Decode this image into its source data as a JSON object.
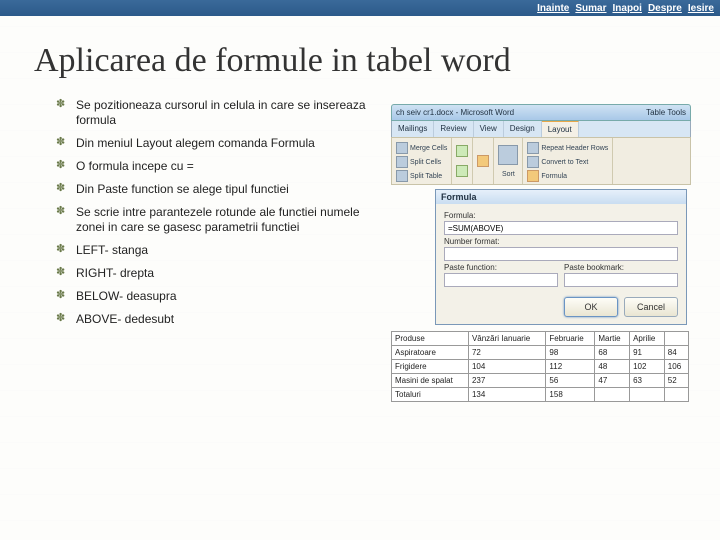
{
  "nav": {
    "inainte": "Inainte",
    "sumar": "Sumar",
    "inapoi": "Inapoi",
    "despre": "Despre",
    "iesire": "Iesire"
  },
  "title": "Aplicarea de formule in tabel word",
  "bullets": [
    "Se pozitioneaza cursorul in celula in care se insereaza formula",
    "Din meniul Layout alegem comanda Formula",
    "O formula incepe cu =",
    "Din Paste function se alege tipul functiei",
    "Se scrie intre parantezele rotunde ale functiei numele zonei in care se gasesc parametrii functiei",
    "LEFT- stanga",
    "RIGHT- drepta",
    "BELOW- deasupra",
    "ABOVE- dedesubt"
  ],
  "word": {
    "docTitle": "ch seiv cr1.docx - Microsoft Word",
    "toolsLabel": "Table Tools",
    "tabs": [
      "Mailings",
      "Review",
      "View",
      "Design",
      "Layout"
    ],
    "activeTab": "Layout",
    "ribbon": {
      "mergeCells": "Merge Cells",
      "splitCells": "Split Cells",
      "splitTable": "Split Table",
      "repeatHeader": "Repeat Header Rows",
      "convertText": "Convert to Text",
      "formula": "Formula",
      "sort": "Sort"
    }
  },
  "dialog": {
    "title": "Formula",
    "formulaLabel": "Formula:",
    "formulaValue": "=SUM(ABOVE)",
    "numberFmt": "Number format:",
    "pasteFn": "Paste function:",
    "pasteBm": "Paste bookmark:",
    "ok": "OK",
    "cancel": "Cancel"
  },
  "chart_data": {
    "type": "table",
    "columns": [
      "Produse",
      "Vânzări Ianuarie",
      "Februarie",
      "Martie",
      "Aprilie"
    ],
    "rows": [
      [
        "Aspiratoare",
        "72",
        "98",
        "68",
        "91",
        "84"
      ],
      [
        "Frigidere",
        "104",
        "112",
        "48",
        "102",
        "106"
      ],
      [
        "Masini de spalat",
        "237",
        "56",
        "47",
        "63",
        "52"
      ],
      [
        "Totaluri",
        "134",
        "158",
        "",
        "",
        ""
      ]
    ]
  }
}
